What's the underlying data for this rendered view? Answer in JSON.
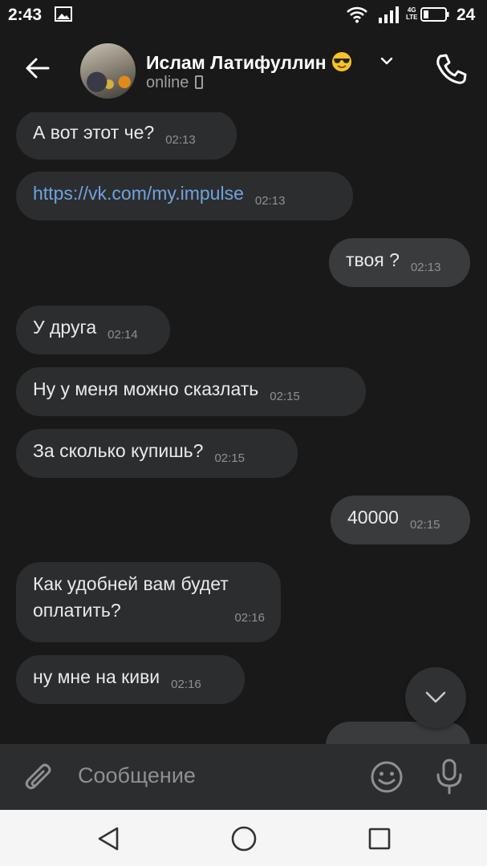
{
  "status_bar": {
    "time": "2:43",
    "network": "4G\nLTE",
    "battery_level": "24"
  },
  "header": {
    "contact_name": "Ислам Латифуллин",
    "status": "online"
  },
  "messages": [
    {
      "direction": "in",
      "text": "А вот этот че?",
      "time": "02:13"
    },
    {
      "direction": "in",
      "text": "https://vk.com/my.impulse",
      "time": "02:13",
      "is_link": true
    },
    {
      "direction": "out",
      "text": "твоя ?",
      "time": "02:13"
    },
    {
      "direction": "in",
      "text": "У друга",
      "time": "02:14"
    },
    {
      "direction": "in",
      "text": "Ну у меня можно сказлать",
      "time": "02:15"
    },
    {
      "direction": "in",
      "text": "За сколько купишь?",
      "time": "02:15"
    },
    {
      "direction": "out",
      "text": "40000",
      "time": "02:15"
    },
    {
      "direction": "in",
      "text": "Как удобней вам будет оплатить?",
      "time": "02:16"
    },
    {
      "direction": "in",
      "text": "ну мне на киви",
      "time": "02:16"
    }
  ],
  "composer": {
    "placeholder": "Сообщение"
  },
  "colors": {
    "background": "#19191a",
    "bubble_in": "#2c2d2e",
    "bubble_out": "#3a3b3d",
    "link": "#6fa3de"
  },
  "icons": {
    "back": "arrow-left-icon",
    "call": "phone-icon",
    "expand": "chevron-down-icon",
    "scroll_down": "chevron-down-icon",
    "attach": "paperclip-icon",
    "emoji": "smiley-icon",
    "voice": "microphone-icon"
  }
}
